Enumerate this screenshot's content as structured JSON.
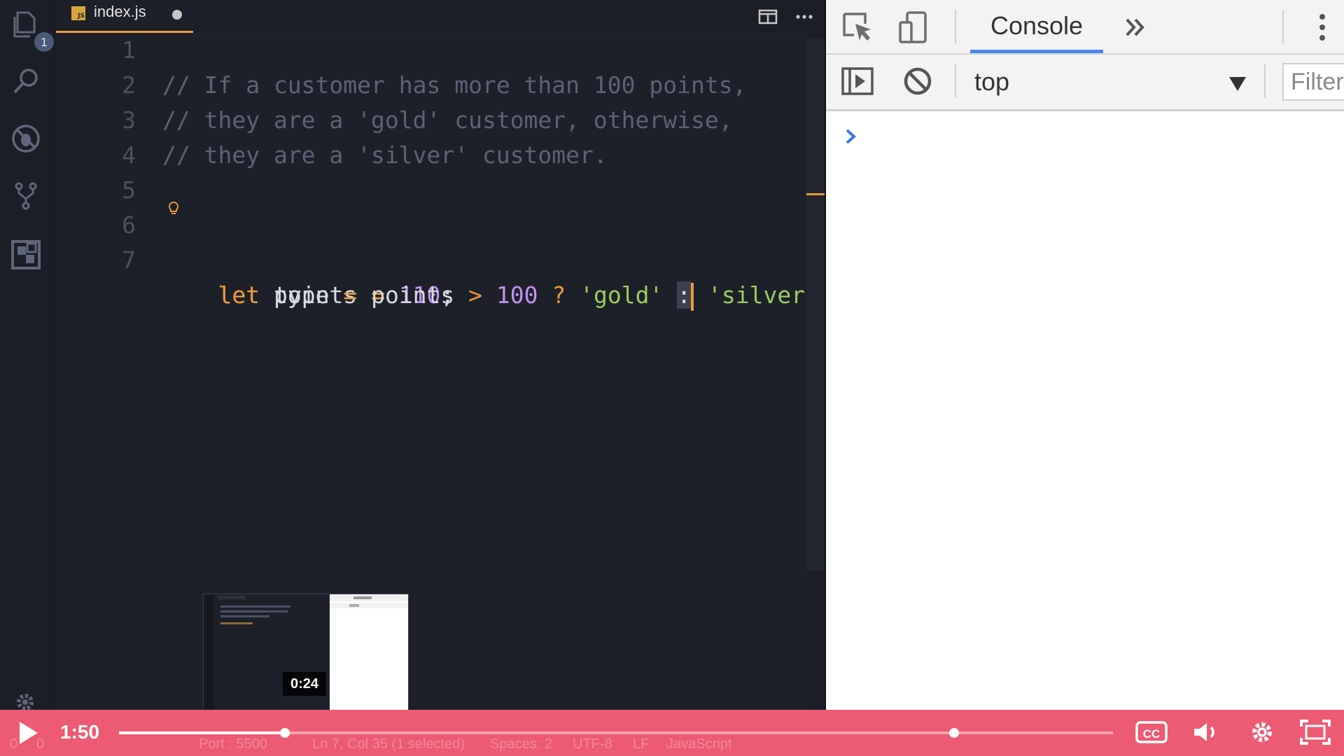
{
  "editor": {
    "tab_label": "index.js",
    "file_badge": "JS",
    "explorer_badge": "1",
    "line_numbers": [
      "1",
      "2",
      "3",
      "4",
      "5",
      "6",
      "7"
    ],
    "lines": {
      "l2": "// If a customer has more than 100 points,",
      "l3": "// they are a 'gold' customer, otherwise,",
      "l4": "// they are a 'silver' customer.",
      "l6": {
        "kw": "let",
        "name": "points",
        "eq": "=",
        "num": "110",
        "end": ";"
      },
      "l7": {
        "kw": "let",
        "name": "type",
        "eq": "=",
        "ref": "points",
        "gt": ">",
        "num": "100",
        "q": "?",
        "s1": "'gold'",
        "colon": ":",
        "s2": "'silver'",
        "end": ";"
      }
    }
  },
  "devtools": {
    "console_tab": "Console",
    "context": "top",
    "filter_placeholder": "Filter"
  },
  "status_bar": {
    "errors": "0",
    "warnings": "0",
    "port": "Port : 5500",
    "position": "Ln 7, Col 35 (1 selected)",
    "spaces": "Spaces: 2",
    "encoding": "UTF-8",
    "eol": "LF",
    "language": "JavaScript"
  },
  "player": {
    "current_time": "1:50",
    "preview_time": "0:24",
    "played_fraction": 0.167,
    "buffered_fraction": 0.84
  },
  "colors": {
    "accent_orange": "#e89a3e",
    "player_bar": "#ec5a73",
    "console_tab_underline": "#4a86e8"
  }
}
